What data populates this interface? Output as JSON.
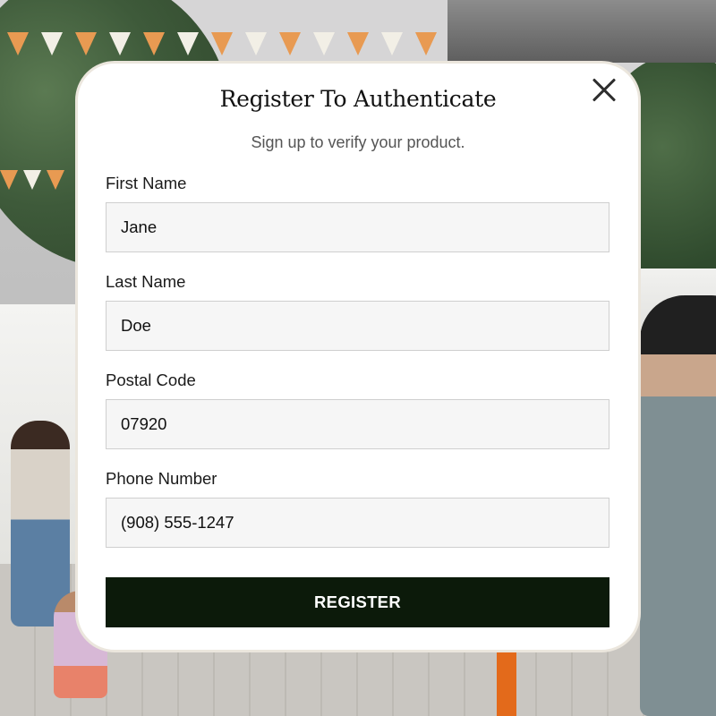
{
  "modal": {
    "title": "Register To Authenticate",
    "subtitle": "Sign up to verify your product.",
    "close_icon": "close-icon",
    "fields": [
      {
        "label": "First Name",
        "value": "Jane"
      },
      {
        "label": "Last Name",
        "value": "Doe"
      },
      {
        "label": "Postal Code",
        "value": "07920"
      },
      {
        "label": "Phone Number",
        "value": "(908) 555-1247"
      }
    ],
    "register_label": "REGISTER"
  },
  "colors": {
    "button_bg": "#0c1a0a",
    "modal_border": "#ebe6dd",
    "input_bg": "#f6f6f6"
  }
}
